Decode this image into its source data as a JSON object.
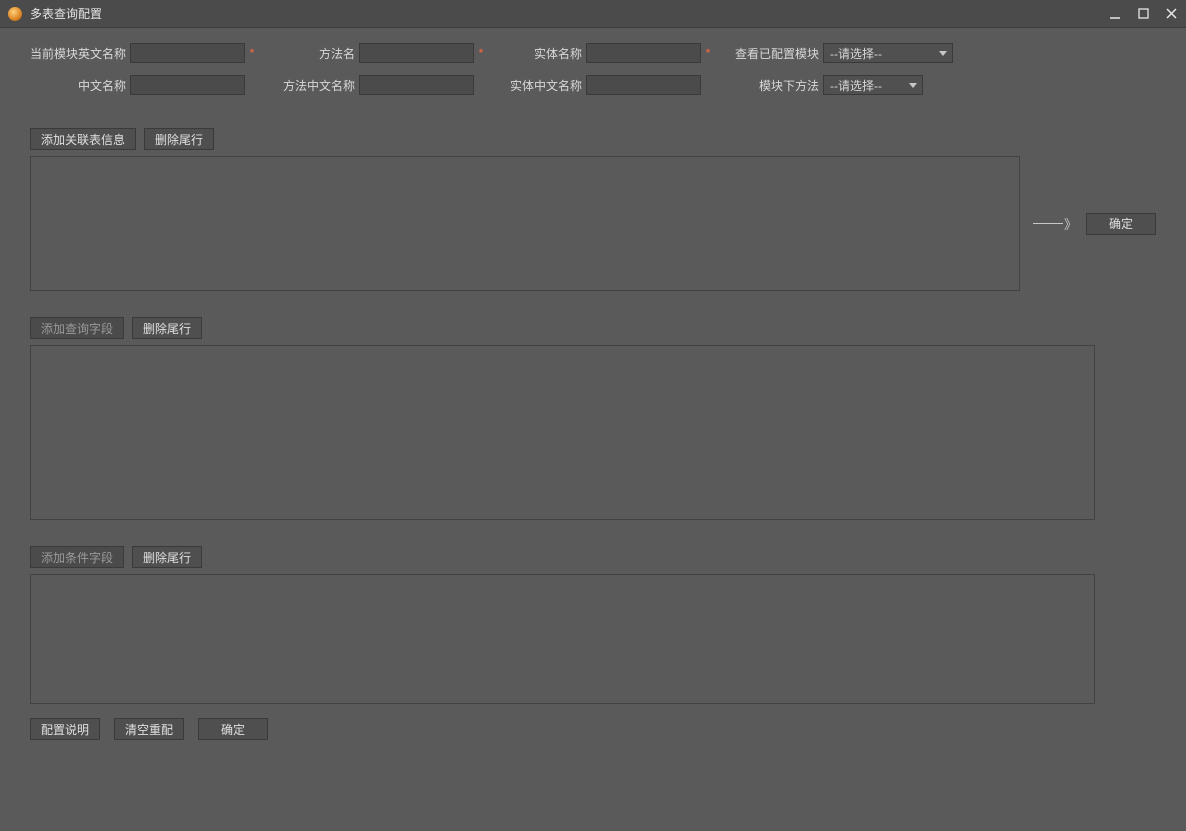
{
  "title": "多表查询配置",
  "form": {
    "row1": {
      "module_en_label": "当前模块英文名称",
      "module_en_value": "",
      "method_label": "方法名",
      "method_value": "",
      "entity_label": "实体名称",
      "entity_value": "",
      "view_configured_label": "查看已配置模块",
      "view_configured_selected": "--请选择--"
    },
    "row2": {
      "cn_name_label": "中文名称",
      "cn_name_value": "",
      "method_cn_label": "方法中文名称",
      "method_cn_value": "",
      "entity_cn_label": "实体中文名称",
      "entity_cn_value": "",
      "module_method_label": "模块下方法",
      "module_method_selected": "--请选择--"
    }
  },
  "sections": {
    "rel": {
      "add": "添加关联表信息",
      "del": "删除尾行"
    },
    "query": {
      "add": "添加查询字段",
      "del": "删除尾行"
    },
    "cond": {
      "add": "添加条件字段",
      "del": "删除尾行"
    }
  },
  "side_confirm": "确定",
  "footer": {
    "desc": "配置说明",
    "reset": "清空重配",
    "ok": "确定"
  },
  "required_mark": "*"
}
